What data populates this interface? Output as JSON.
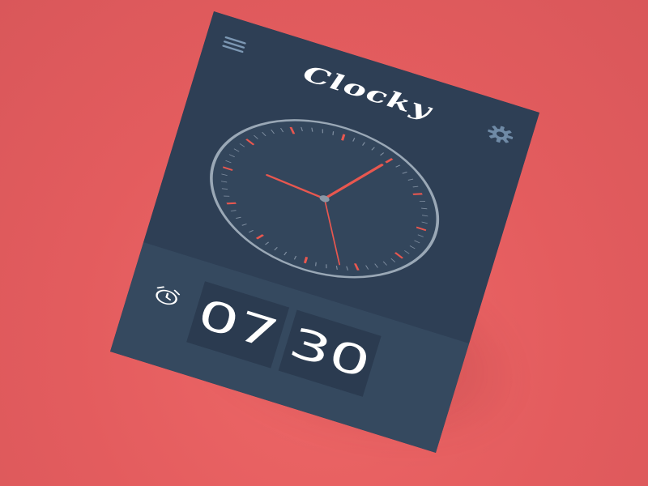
{
  "app": {
    "title": "Clocky"
  },
  "alarm": {
    "hours": "07",
    "minutes": "30"
  },
  "clock": {
    "hour_hand_deg": -82,
    "minute_hand_deg": 30,
    "second_hand_deg": 160
  },
  "icons": {
    "menu": "hamburger-menu-icon",
    "settings": "gear-icon",
    "alarm": "alarm-clock-icon"
  },
  "colors": {
    "background": "#e35c5e",
    "panel": "#2e3f55",
    "panel_light": "#35495f",
    "accent": "#e8574f",
    "clock_ring": "#9aa8b6"
  }
}
